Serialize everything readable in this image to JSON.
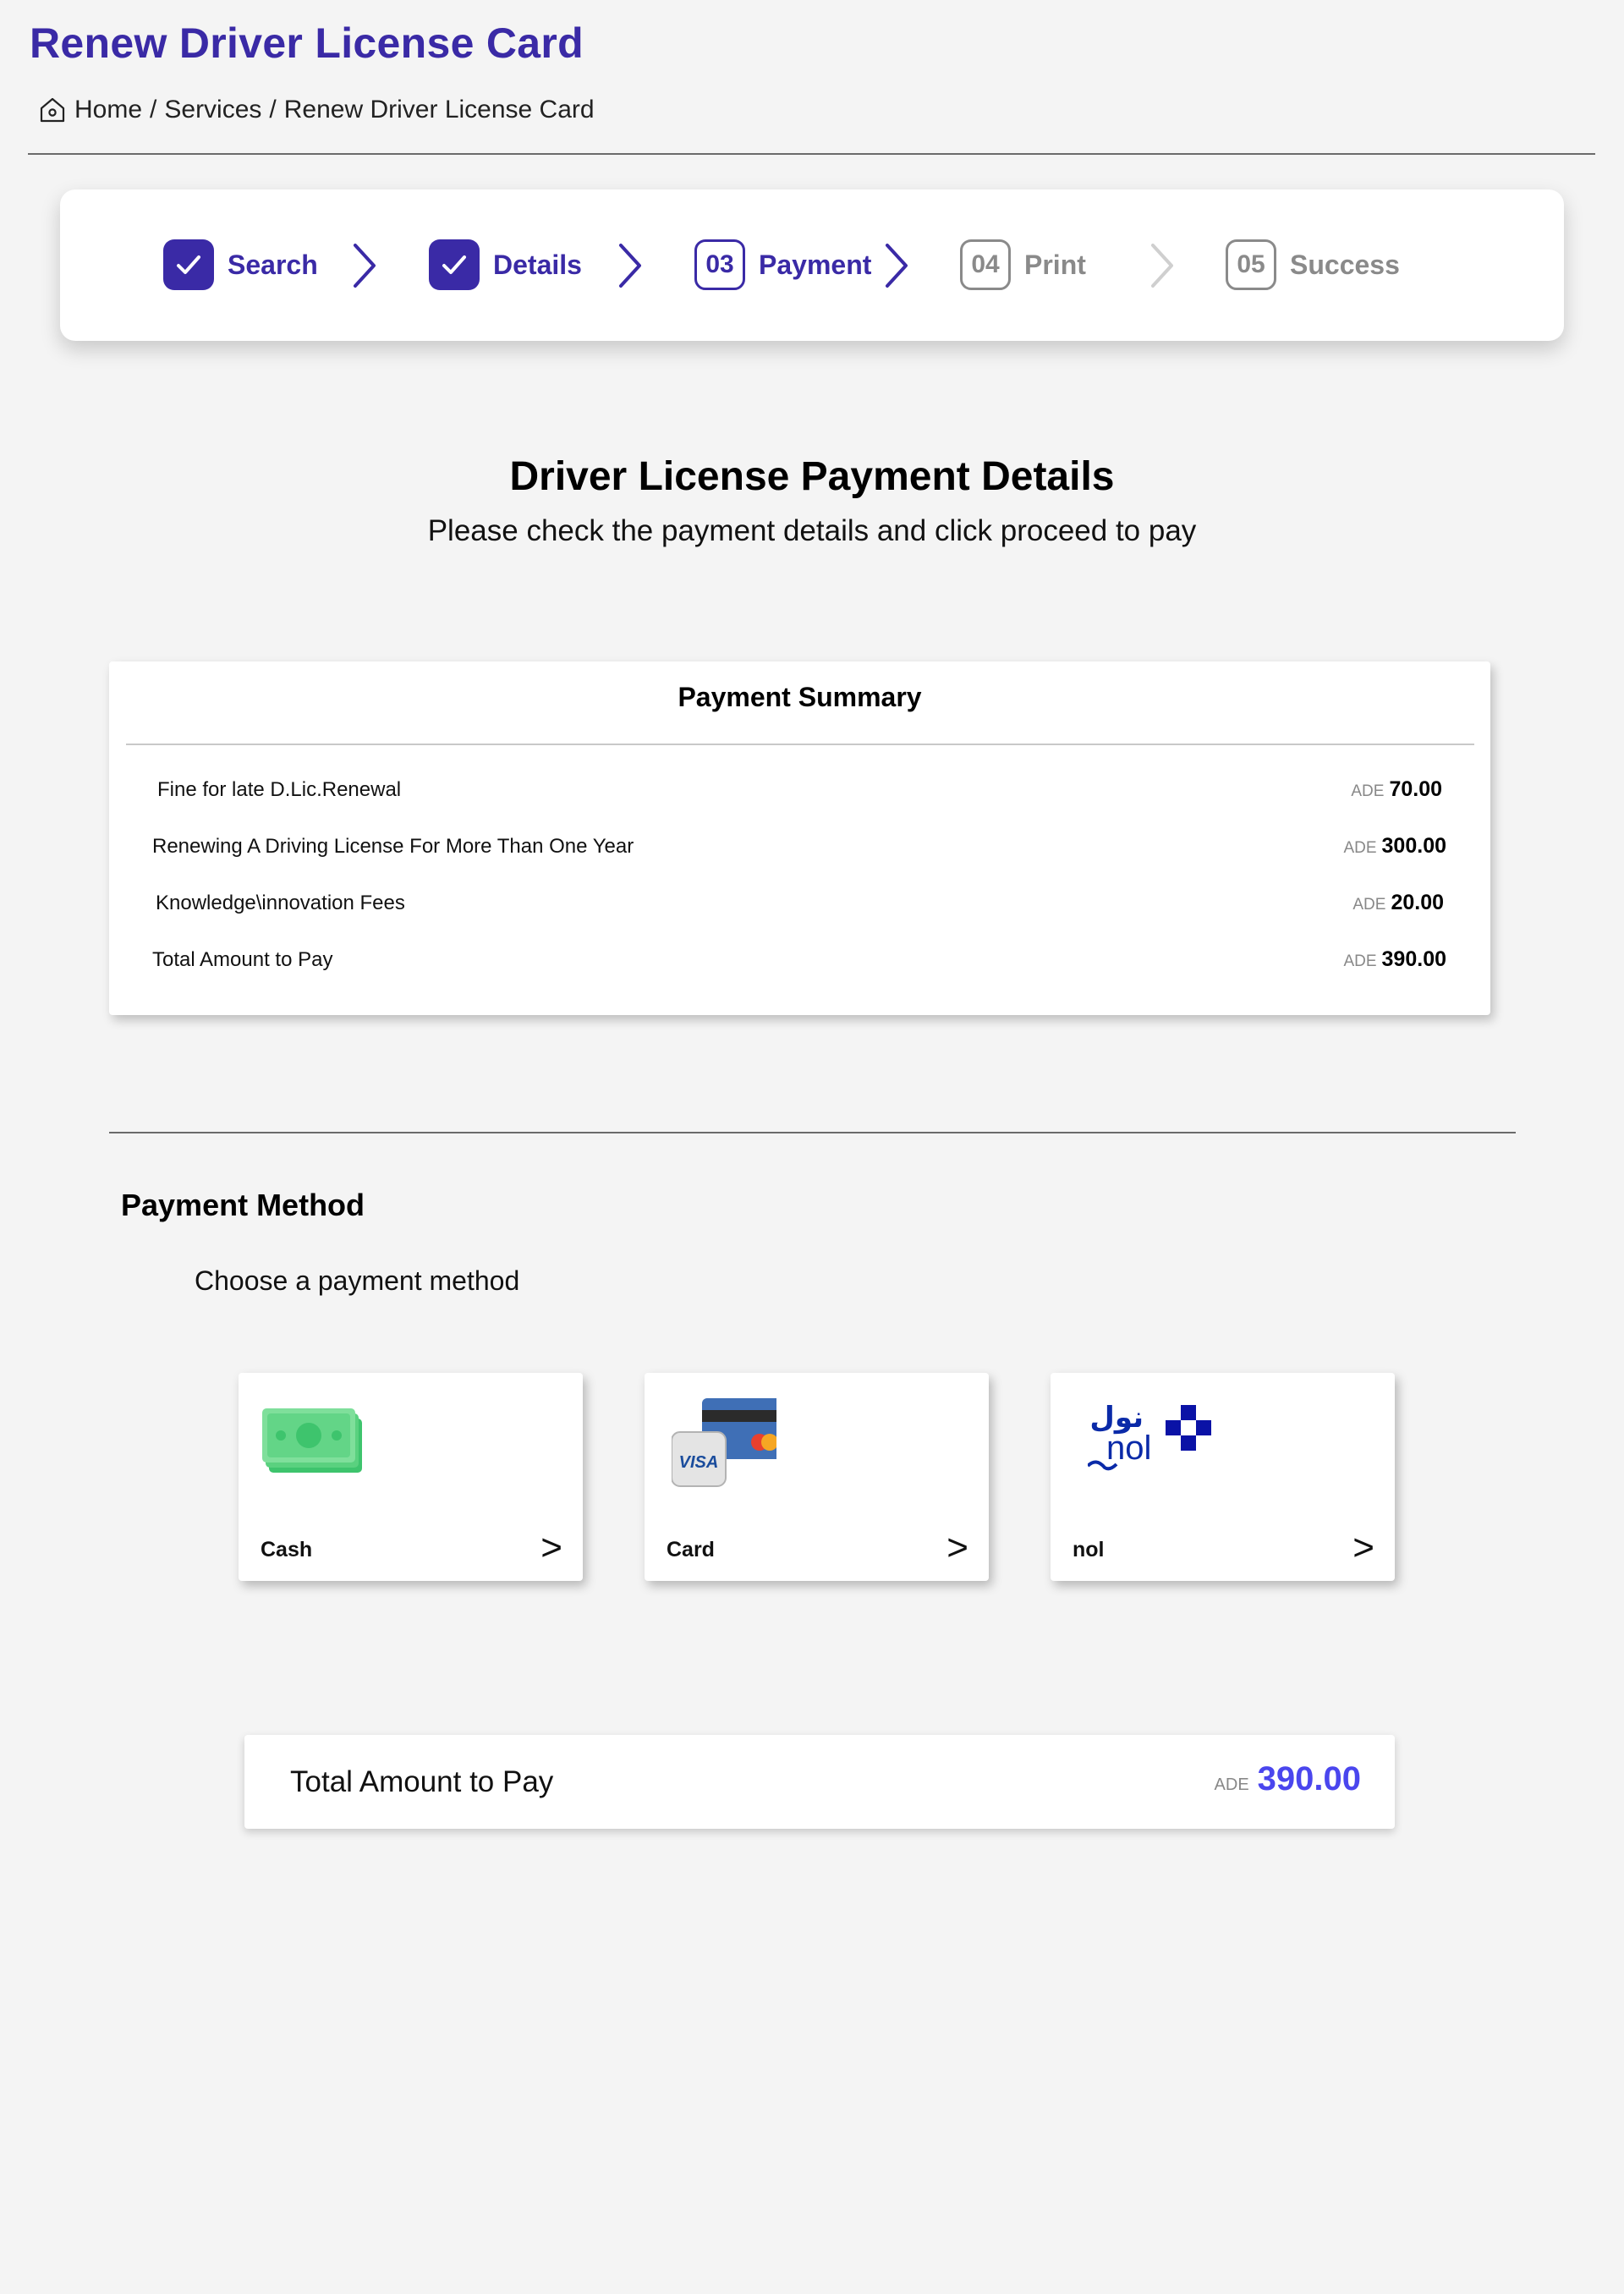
{
  "header": {
    "title": "Renew Driver License Card",
    "breadcrumb": [
      "Home",
      "Services",
      "Renew Driver License Card"
    ],
    "breadcrumb_separator": "/"
  },
  "stepper": {
    "steps": [
      {
        "number": "",
        "label": "Search",
        "state": "done"
      },
      {
        "number": "",
        "label": "Details",
        "state": "done"
      },
      {
        "number": "03",
        "label": "Payment",
        "state": "active"
      },
      {
        "number": "04",
        "label": "Print",
        "state": "todo"
      },
      {
        "number": "05",
        "label": "Success",
        "state": "todo"
      }
    ]
  },
  "section": {
    "title": "Driver License Payment Details",
    "subtitle": "Please check the payment details and click proceed to pay"
  },
  "summary": {
    "title": "Payment Summary",
    "rows": [
      {
        "label": "Fine for late D.Lic.Renewal",
        "currency": "ADE",
        "amount": "70.00"
      },
      {
        "label": "Renewing A Driving License For More Than One Year",
        "currency": "ADE",
        "amount": "300.00"
      },
      {
        "label": "Knowledge\\innovation Fees",
        "currency": "ADE",
        "amount": "20.00"
      },
      {
        "label": "Total Amount to Pay",
        "currency": "ADE",
        "amount": "390.00"
      }
    ]
  },
  "payment_method": {
    "title": "Payment Method",
    "subtitle": "Choose a payment method",
    "arrow": ">",
    "methods": [
      {
        "label": "Cash",
        "icon": "cash-icon"
      },
      {
        "label": "Card",
        "icon": "card-icon",
        "icon_text": "VISA"
      },
      {
        "label": "nol",
        "icon": "nol-icon",
        "icon_text": "nol",
        "icon_text_ar": "نول"
      }
    ]
  },
  "total": {
    "label": "Total Amount to Pay",
    "currency": "ADE",
    "amount": "390.00"
  },
  "colors": {
    "brand": "#3a2aa6",
    "inactive": "#8a8a8a",
    "total_amount": "#4a46ee",
    "background": "#f4f4f4"
  }
}
